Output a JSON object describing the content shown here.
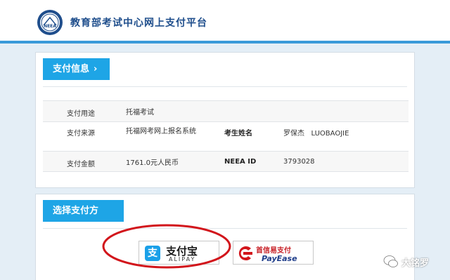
{
  "header": {
    "site_title": "教育部考试中心网上支付平台",
    "logo_text": "NEEA"
  },
  "payment_info": {
    "tab_label": "支付信息",
    "rows": [
      {
        "label": "支付用途",
        "value": "托福考试"
      },
      {
        "label": "支付来源",
        "value": "托福网考网上报名系统",
        "label2": "考生姓名",
        "value2": "罗保杰   LUOBAOJIE"
      },
      {
        "label": "支付金额",
        "value": "1761.0元人民币",
        "label2": "NEEA ID",
        "value2": "3793028"
      }
    ]
  },
  "payment_method": {
    "tab_label": "选择支付方式",
    "alipay": {
      "icon": "支",
      "name": "支付宝",
      "sub": "ALIPAY"
    },
    "payease": {
      "name": "首信易支付",
      "sub": "PayEase"
    }
  },
  "watermark": {
    "text": "大铭罗"
  },
  "colors": {
    "accent": "#1ea5e6",
    "header_rule": "#3a9ad9",
    "highlight_circle": "#d2151b"
  }
}
